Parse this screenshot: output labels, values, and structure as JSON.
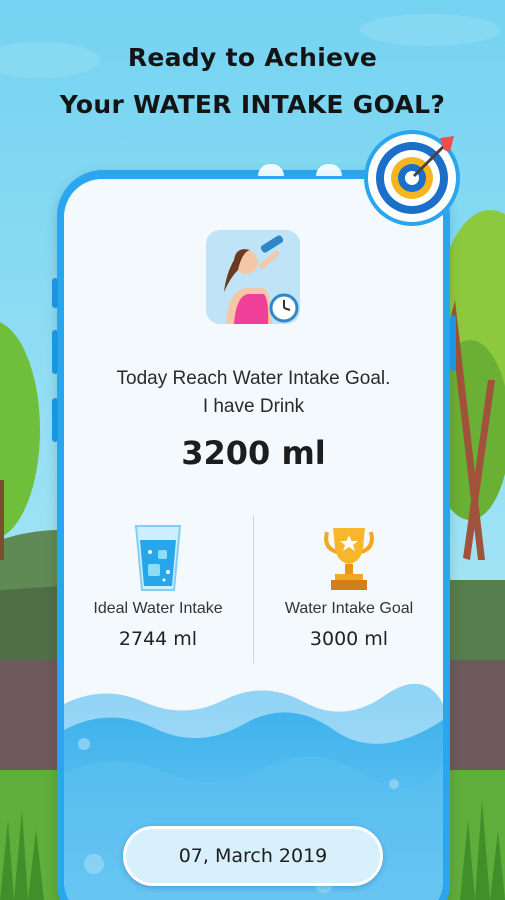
{
  "headline": {
    "line1": "Ready to Achieve",
    "line2": "Your WATER INTAKE GOAL?"
  },
  "card": {
    "message_line1": "Today Reach Water Intake Goal.",
    "message_line2": "I have Drink",
    "amount": "3200 ml",
    "ideal": {
      "label": "Ideal Water Intake",
      "value": "2744 ml",
      "icon": "water-glass-icon"
    },
    "goal": {
      "label": "Water Intake Goal",
      "value": "3000 ml",
      "icon": "trophy-icon"
    },
    "date": "07, March 2019"
  },
  "colors": {
    "sky": "#7fd6f2",
    "phone_frame": "#2aa6ee",
    "screen": "#f3f9fd",
    "water": "#3ab0ea",
    "trophy": "#f4a722",
    "headline_text": "#141414"
  }
}
